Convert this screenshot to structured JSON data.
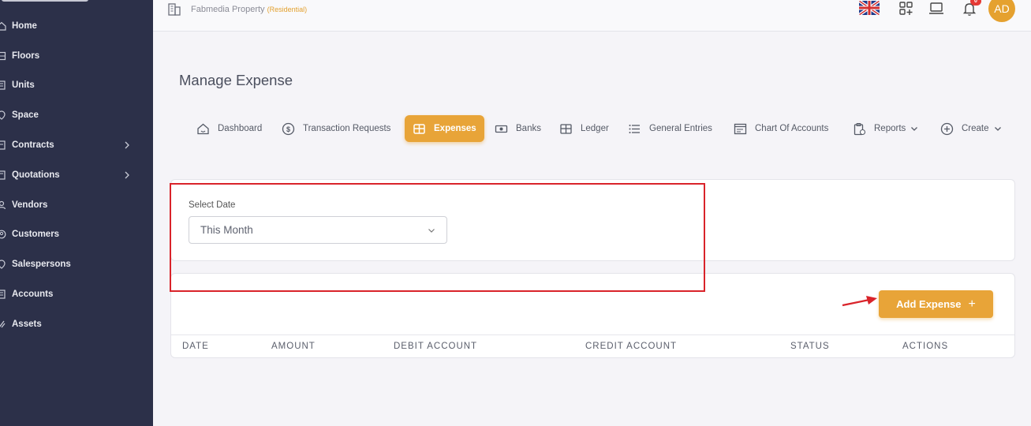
{
  "sidebar": {
    "items": [
      {
        "label": "Home",
        "icon": "home-icon"
      },
      {
        "label": "Floors",
        "icon": "floors-icon"
      },
      {
        "label": "Units",
        "icon": "units-icon"
      },
      {
        "label": "Space",
        "icon": "space-icon"
      },
      {
        "label": "Contracts",
        "icon": "contracts-icon",
        "expandable": true
      },
      {
        "label": "Quotations",
        "icon": "quotations-icon",
        "expandable": true
      },
      {
        "label": "Vendors",
        "icon": "vendors-icon"
      },
      {
        "label": "Customers",
        "icon": "customers-icon"
      },
      {
        "label": "Salespersons",
        "icon": "salespersons-icon"
      },
      {
        "label": "Accounts",
        "icon": "accounts-icon"
      },
      {
        "label": "Assets",
        "icon": "assets-icon"
      }
    ]
  },
  "topbar": {
    "property_name": "Fabmedia Property",
    "property_type": "(Residential)",
    "notification_count": "0",
    "avatar_initials": "AD",
    "language_flag": "uk-flag-icon"
  },
  "page": {
    "title": "Manage Expense"
  },
  "tabs": [
    {
      "label": "Dashboard",
      "icon": "dashboard-icon"
    },
    {
      "label": "Transaction Requests",
      "icon": "dollar-icon"
    },
    {
      "label": "Expenses",
      "icon": "table-icon",
      "active": true
    },
    {
      "label": "Banks",
      "icon": "banknote-icon"
    },
    {
      "label": "Ledger",
      "icon": "ledger-icon"
    },
    {
      "label": "General Entries",
      "icon": "list-icon"
    },
    {
      "label": "Chart Of Accounts",
      "icon": "chart-accounts-icon"
    },
    {
      "label": "Reports",
      "icon": "clipboard-icon",
      "dropdown": true
    },
    {
      "label": "Create",
      "icon": "plus-circle-icon",
      "dropdown": true
    }
  ],
  "filter": {
    "label": "Select Date",
    "value": "This Month"
  },
  "actions": {
    "add_expense_label": "Add Expense"
  },
  "table": {
    "columns": [
      "DATE",
      "AMOUNT",
      "DEBIT ACCOUNT",
      "CREDIT ACCOUNT",
      "STATUS",
      "ACTIONS"
    ]
  },
  "colors": {
    "sidebar_bg": "#2c3049",
    "accent": "#e8a438",
    "annotation_red": "#d9232a"
  }
}
